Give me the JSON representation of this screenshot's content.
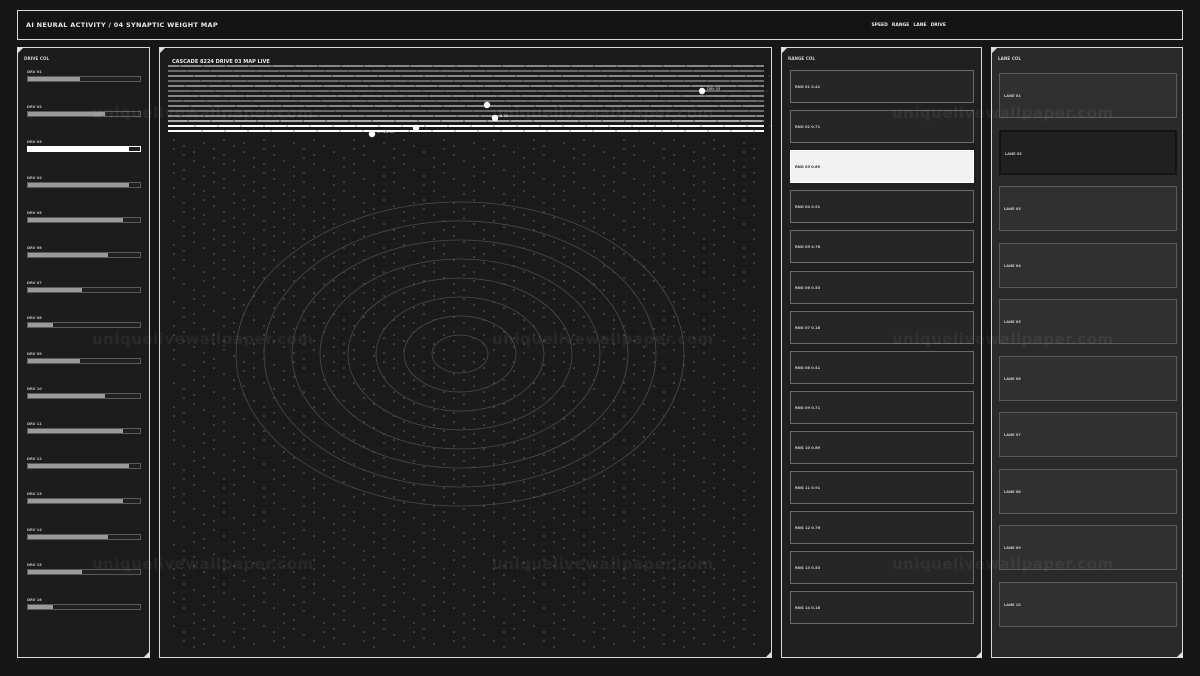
{
  "header": {
    "title": "AI NEURAL ACTIVITY  /  04  SYNAPTIC WEIGHT MAP",
    "nav": [
      "SPEED",
      "RANGE",
      "LANE",
      "DRIVE"
    ]
  },
  "drive_panel": {
    "title": "DRIVE COL",
    "items": [
      {
        "label": "DRV 01",
        "level": 0.46
      },
      {
        "label": "DRV 02",
        "level": 0.69
      },
      {
        "label": "DRV 03",
        "level": 0.9,
        "active": true
      },
      {
        "label": "DRV 04",
        "level": 0.9
      },
      {
        "label": "DRV 05",
        "level": 0.85
      },
      {
        "label": "DRV 06",
        "level": 0.71
      },
      {
        "label": "DRV 07",
        "level": 0.48
      },
      {
        "label": "DRV 08",
        "level": 0.22
      },
      {
        "label": "DRV 09",
        "level": 0.46
      },
      {
        "label": "DRV 10",
        "level": 0.69
      },
      {
        "label": "DRV 11",
        "level": 0.85
      },
      {
        "label": "DRV 12",
        "level": 0.9
      },
      {
        "label": "DRV 13",
        "level": 0.85
      },
      {
        "label": "DRV 14",
        "level": 0.71
      },
      {
        "label": "DRV 15",
        "level": 0.48
      },
      {
        "label": "DRV 16",
        "level": 0.22
      }
    ]
  },
  "map": {
    "title": "CASCADE 8224  DRIVE 03  MAP LIVE",
    "nodes": [
      {
        "label": "DRV 03",
        "tag": "n1"
      },
      {
        "label": "",
        "tag": "n2"
      },
      {
        "label": "8.33",
        "tag": "n3"
      },
      {
        "label": "",
        "tag": "n4"
      },
      {
        "label": "SPEED 04",
        "tag": "n5"
      }
    ]
  },
  "range_panel": {
    "title": "RANGE COL",
    "items": [
      {
        "label": "RNG 01  0.41"
      },
      {
        "label": "RNG 02  0.71"
      },
      {
        "label": "RNG 03  0.89",
        "active": true
      },
      {
        "label": "RNG 04  0.91"
      },
      {
        "label": "RNG 05  0.76"
      },
      {
        "label": "RNG 06  0.53"
      },
      {
        "label": "RNG 07  0.18"
      },
      {
        "label": "RNG 08  0.41"
      },
      {
        "label": "RNG 09  0.71"
      },
      {
        "label": "RNG 10  0.89"
      },
      {
        "label": "RNG 11  0.91"
      },
      {
        "label": "RNG 12  0.76"
      },
      {
        "label": "RNG 13  0.53"
      },
      {
        "label": "RNG 14  0.18"
      }
    ]
  },
  "lane_panel": {
    "title": "LANE COL",
    "items": [
      {
        "label": "LANE 01"
      },
      {
        "label": "LANE 02",
        "active": true
      },
      {
        "label": "LANE 03"
      },
      {
        "label": "LANE 04"
      },
      {
        "label": "LANE 05"
      },
      {
        "label": "LANE 06"
      },
      {
        "label": "LANE 07"
      },
      {
        "label": "LANE 08"
      },
      {
        "label": "LANE 09"
      },
      {
        "label": "LANE 10"
      }
    ]
  },
  "watermark": "uniquelivewallpaper.com"
}
